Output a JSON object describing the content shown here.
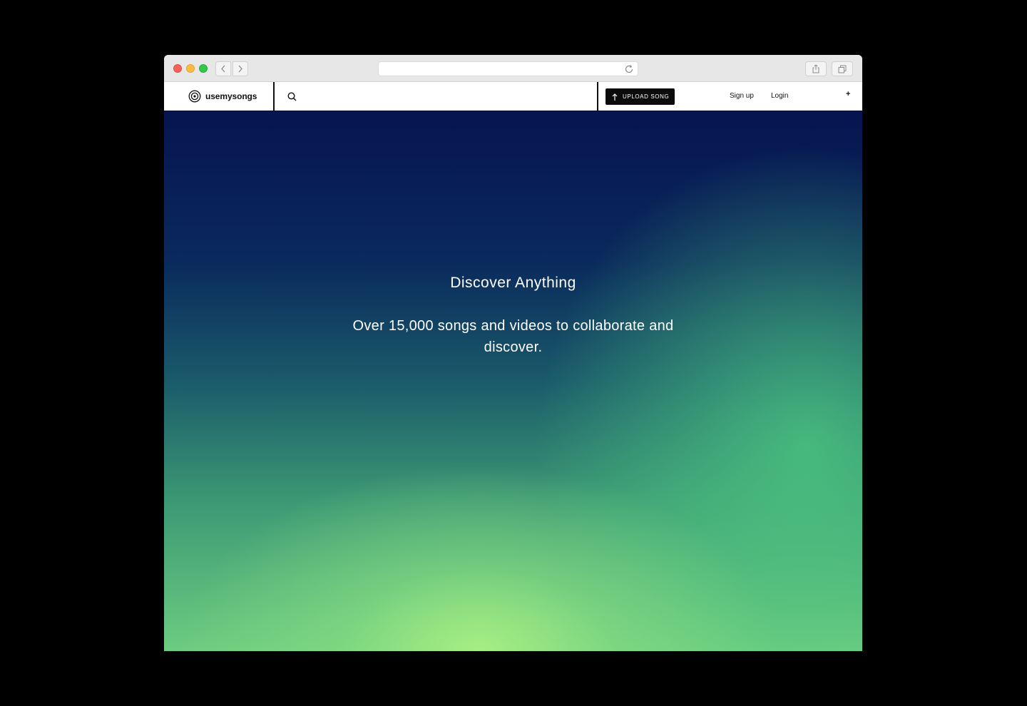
{
  "browser": {
    "url": "",
    "icons": [
      "back-icon",
      "forward-icon",
      "reload-icon",
      "share-icon",
      "tabs-icon"
    ]
  },
  "site": {
    "logo_text": "usemysongs",
    "upload_label": "UPLOAD SONG",
    "signup_label": "Sign up",
    "login_label": "Login",
    "plus_label": "+"
  },
  "hero": {
    "title": "Discover Anything",
    "subtitle": "Over 15,000 songs and videos to collaborate and discover."
  },
  "colors": {
    "background": "#000000",
    "hero_top": "#061450",
    "hero_bottom": "#a6ef84",
    "button": "#0b0b0b"
  }
}
